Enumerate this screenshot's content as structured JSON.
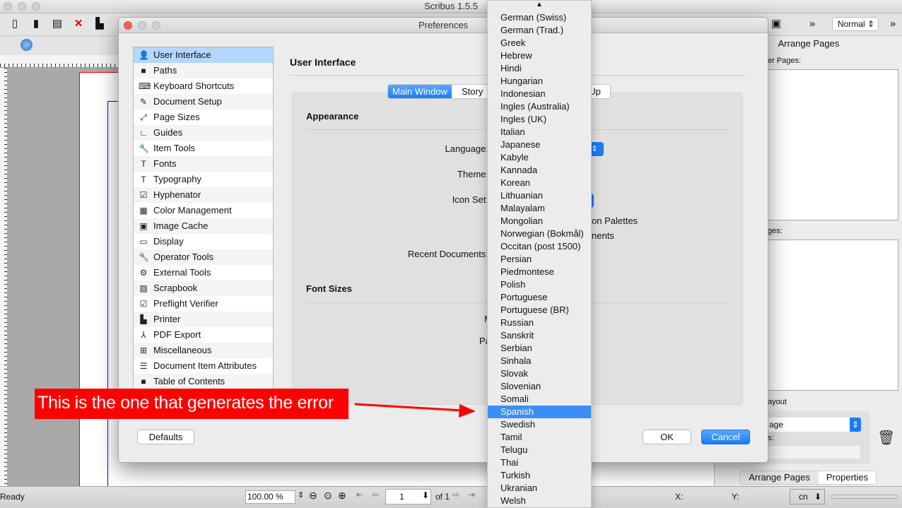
{
  "app": {
    "title": "Scribus 1.5.5",
    "mode_select": "Normal"
  },
  "dialog": {
    "title": "Preferences",
    "sidebar": [
      {
        "label": "User Interface",
        "icon": "user-icon",
        "selected": true
      },
      {
        "label": "Paths",
        "icon": "folder-icon"
      },
      {
        "label": "Keyboard Shortcuts",
        "icon": "keyboard-icon"
      },
      {
        "label": "Document Setup",
        "icon": "document-icon"
      },
      {
        "label": "Page Sizes",
        "icon": "resize-icon"
      },
      {
        "label": "Guides",
        "icon": "guides-icon"
      },
      {
        "label": "Item Tools",
        "icon": "wrench-icon"
      },
      {
        "label": "Fonts",
        "icon": "font-icon"
      },
      {
        "label": "Typography",
        "icon": "typography-icon"
      },
      {
        "label": "Hyphenator",
        "icon": "checkbox-icon"
      },
      {
        "label": "Color Management",
        "icon": "color-icon"
      },
      {
        "label": "Image Cache",
        "icon": "image-icon"
      },
      {
        "label": "Display",
        "icon": "monitor-icon"
      },
      {
        "label": "Operator Tools",
        "icon": "wrench-icon"
      },
      {
        "label": "External Tools",
        "icon": "gear-icon"
      },
      {
        "label": "Scrapbook",
        "icon": "scrapbook-icon"
      },
      {
        "label": "Preflight Verifier",
        "icon": "checkbox-icon"
      },
      {
        "label": "Printer",
        "icon": "printer-icon"
      },
      {
        "label": "PDF Export",
        "icon": "pdf-icon"
      },
      {
        "label": "Miscellaneous",
        "icon": "plus-icon"
      },
      {
        "label": "Document Item Attributes",
        "icon": "list-icon"
      },
      {
        "label": "Table of Contents",
        "icon": "toc-icon"
      }
    ],
    "heading": "User Interface",
    "tabs": [
      {
        "label": "Main Window",
        "active": true
      },
      {
        "label": "Story"
      },
      {
        "label": "Start Up"
      }
    ],
    "appearance": {
      "title": "Appearance",
      "language_label": "Language:",
      "theme_label": "Theme:",
      "icon_set_label": "Icon Set:",
      "palettes_partial": "on Palettes",
      "documents_partial": "nents",
      "recent_label": "Recent Documents:"
    },
    "font_sizes": {
      "title": "Font Sizes",
      "menu_partial": "M",
      "palette_partial": "Pa"
    },
    "buttons": {
      "defaults": "Defaults",
      "ok": "OK",
      "cancel": "Cancel"
    }
  },
  "language_dropdown": {
    "items": [
      "German (Swiss)",
      "German (Trad.)",
      "Greek",
      "Hebrew",
      "Hindi",
      "Hungarian",
      "Indonesian",
      "Ingles (Australia)",
      "Ingles (UK)",
      "Italian",
      "Japanese",
      "Kabyle",
      "Kannada",
      "Korean",
      "Lithuanian",
      "Malayalam",
      "Mongolian",
      "Norwegian (Bokmål)",
      "Occitan (post 1500)",
      "Persian",
      "Piedmontese",
      "Polish",
      "Portuguese",
      "Portuguese (BR)",
      "Russian",
      "Sanskrit",
      "Serbian",
      "Sinhala",
      "Slovak",
      "Slovenian",
      "Somali",
      "Spanish",
      "Swedish",
      "Tamil",
      "Telugu",
      "Thai",
      "Turkish",
      "Ukranian",
      "Welsh"
    ],
    "selected": "Spanish"
  },
  "annotation": {
    "text": "This is the one that generates the error",
    "color": "#ff0000"
  },
  "right_panel": {
    "title": "Arrange Pages",
    "master_pages_partial": "er Pages:",
    "pages_partial": "ges:",
    "layout_partial": "ayout",
    "layout_select_partial": "age",
    "second_label_partial": "s:",
    "tabs": [
      "Arrange Pages",
      "Properties"
    ]
  },
  "status": {
    "text": "Ready",
    "zoom": "100.00 %",
    "page": "1",
    "of": "of 1",
    "x_label": "X:",
    "y_label": "Y:",
    "unit": "cn"
  },
  "colors": {
    "accent": "#1a7cf5",
    "selection": "#b3d7ff"
  }
}
